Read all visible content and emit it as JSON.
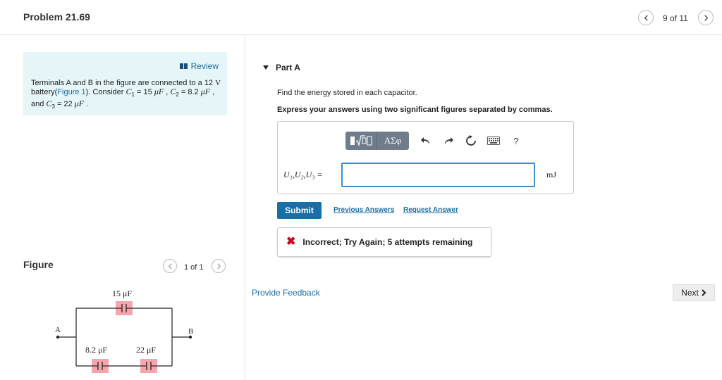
{
  "header": {
    "title": "Problem 21.69",
    "page_indicator": "9 of 11"
  },
  "review": {
    "label": "Review",
    "text_pre": "Terminals A and B in the figure are connected to a 12 ",
    "volt_unit": "V",
    "text_battery": " battery(",
    "figure_link": "Figure 1",
    "text_consider": "). Consider ",
    "c1_symbol": "C",
    "c1_sub": "1",
    "c1_value": " = 15 ",
    "mu_f_1": "μF",
    "sep1": " , ",
    "c2_symbol": "C",
    "c2_sub": "2",
    "c2_value": " = 8.2 ",
    "mu_f_2": "μF",
    "sep2": " , and ",
    "c3_symbol": "C",
    "c3_sub": "3",
    "c3_value": " = 22 ",
    "mu_f_3": "μF",
    "end": " ."
  },
  "figure": {
    "title": "Figure",
    "page_indicator": "1 of 1",
    "circuit": {
      "c1_label": "15 μF",
      "c2_label": "8.2 μF",
      "c3_label": "22 μF",
      "terminal_a": "A",
      "terminal_b": "B"
    }
  },
  "part": {
    "label": "Part A",
    "instruction": "Find the energy stored in each capacitor.",
    "format_hint": "Express your answers using two significant figures separated by commas.",
    "toolbar": {
      "greek_label": "ΑΣφ",
      "help_label": "?"
    },
    "answer_label": "U₁,U₂,U₃ =",
    "answer_value": "",
    "unit": "mJ",
    "submit_label": "Submit",
    "previous_answers_label": "Previous Answers",
    "request_answer_label": "Request Answer",
    "feedback_text": "Incorrect; Try Again; 5 attempts remaining"
  },
  "footer": {
    "provide_feedback": "Provide Feedback",
    "next_label": "Next"
  },
  "colors": {
    "link": "#1a6ea8",
    "submit": "#1a6ea8",
    "review_bg": "#e6f5f7",
    "error": "#d0021b",
    "capacitor_highlight": "#f4a6ac"
  }
}
